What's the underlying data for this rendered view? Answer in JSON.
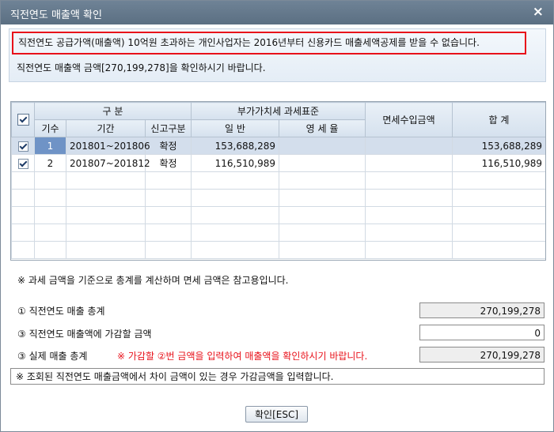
{
  "window": {
    "title": "직전연도 매출액 확인",
    "close_icon": "×"
  },
  "notice": {
    "warning": "직전연도 공급가액(매출액) 10억원 초과하는 개인사업자는 2016년부터 신용카드 매출세액공제를 받을 수 없습니다.",
    "info": "직전연도 매출액 금액[270,199,278]을 확인하시기 바랍니다."
  },
  "grid": {
    "headers": {
      "group_gubun": "구 분",
      "kisu": "기수",
      "period": "기간",
      "report_type": "신고구분",
      "vat_group": "부가가치세 과세표준",
      "general": "일 반",
      "zero_rate": "영 세 율",
      "exempt": "면세수입금액",
      "total": "합 계"
    },
    "rows": [
      {
        "checked": true,
        "kisu": "1",
        "period": "201801~201806",
        "type": "확정",
        "general": "153,688,289",
        "zero_rate": "",
        "exempt": "",
        "total": "153,688,289"
      },
      {
        "checked": true,
        "kisu": "2",
        "period": "201807~201812",
        "type": "확정",
        "general": "116,510,989",
        "zero_rate": "",
        "exempt": "",
        "total": "116,510,989"
      }
    ]
  },
  "note": "※ 과세 금액을 기준으로 총계를 계산하며 면세 금액은 참고용입니다.",
  "summary": {
    "total_label": "① 직전연도 매출 총계",
    "total_value": "270,199,278",
    "adjust_label": "③ 직전연도 매출액에 가감할 금액",
    "adjust_value": "0",
    "actual_label": "③ 실제 매출 총계",
    "actual_hint": "※ 가감할 ②번 금액을 입력하여 매출액을 확인하시기 바랍니다.",
    "actual_value": "270,199,278"
  },
  "message": "※ 조회된 직전연도 매출금액에서 차이 금액이 있는 경우 가감금액을 입력합니다.",
  "confirm_button": "확인[ESC]"
}
